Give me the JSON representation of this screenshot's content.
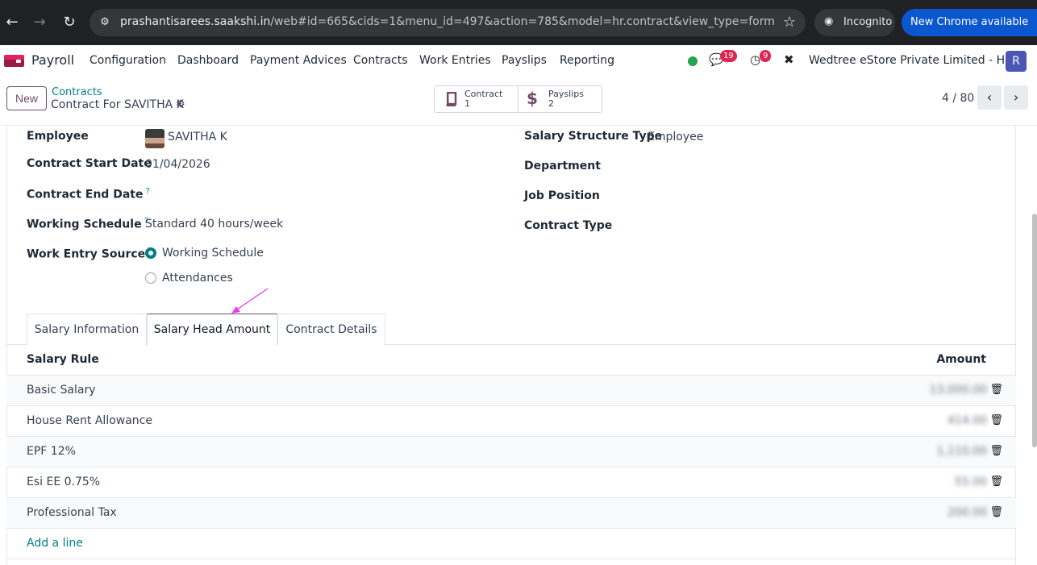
{
  "browser": {
    "url_host": "prashantisarees.saakshi.in",
    "url_path": "/web#id=665&cids=1&menu_id=497&action=785&model=hr.contract&view_type=form",
    "incognito_label": "Incognito",
    "update_label": "New Chrome available"
  },
  "navbar": {
    "app_name": "Payroll",
    "menu": [
      "Configuration",
      "Dashboard",
      "Payment Advices",
      "Contracts",
      "Work Entries",
      "Payslips",
      "Reporting"
    ],
    "messages_badge": "19",
    "activities_badge": "9",
    "company": "Wedtree eStore Private Limited - HO",
    "avatar_initial": "R",
    "status_color": "#22a54b"
  },
  "control_panel": {
    "new_label": "New",
    "breadcrumb": "Contracts",
    "record_name": "Contract For SAVITHA K",
    "smart_buttons": [
      {
        "label": "Contract",
        "value": "1",
        "icon": "book-icon"
      },
      {
        "label": "Payslips",
        "value": "2",
        "icon": "dollar-icon"
      }
    ],
    "pager": "4 / 80"
  },
  "form": {
    "left": [
      {
        "label": "Employee",
        "value": "SAVITHA K"
      },
      {
        "label": "Contract Start Date",
        "value": "01/04/2026"
      },
      {
        "label": "Contract End Date",
        "value": "",
        "help": "?"
      },
      {
        "label": "Working Schedule",
        "value": "Standard 40 hours/week",
        "help": "?"
      },
      {
        "label": "Work Entry Source",
        "help": "?"
      }
    ],
    "work_entry_options": [
      "Working Schedule",
      "Attendances"
    ],
    "right": [
      {
        "label": "Salary Structure Type",
        "value": "Employee"
      },
      {
        "label": "Department",
        "value": ""
      },
      {
        "label": "Job Position",
        "value": ""
      },
      {
        "label": "Contract Type",
        "value": ""
      }
    ]
  },
  "tabs": [
    "Salary Information",
    "Salary Head Amount",
    "Contract Details"
  ],
  "active_tab": "Salary Head Amount",
  "salary_table": {
    "headers": [
      "Salary Rule",
      "Amount"
    ],
    "rows": [
      {
        "rule": "Basic Salary",
        "amount": "13,000.00"
      },
      {
        "rule": "House Rent Allowance",
        "amount": "414.00"
      },
      {
        "rule": "EPF 12%",
        "amount": "1,110.00"
      },
      {
        "rule": "Esi EE 0.75%",
        "amount": "55.00"
      },
      {
        "rule": "Professional Tax",
        "amount": "200.00"
      }
    ],
    "add_line": "Add a line"
  }
}
